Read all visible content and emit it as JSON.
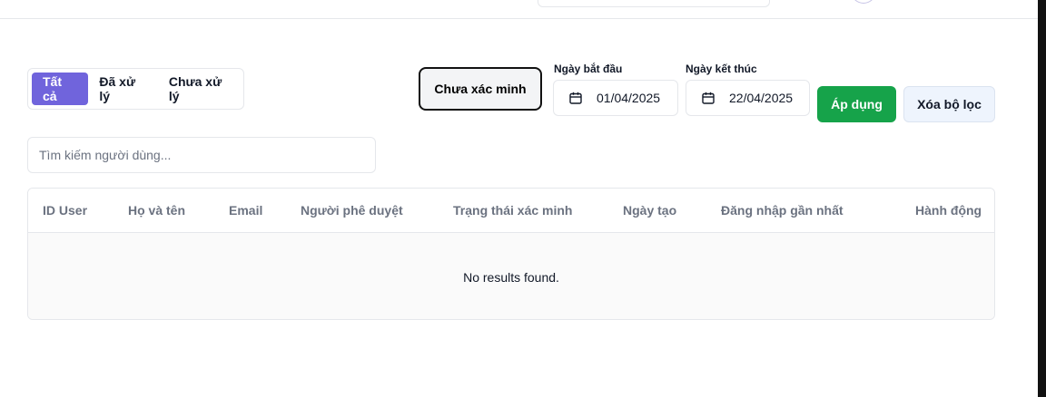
{
  "filters": {
    "tabs": [
      {
        "label": "Tất cả",
        "active": true
      },
      {
        "label": "Đã xử lý",
        "active": false
      },
      {
        "label": "Chưa xử lý",
        "active": false
      }
    ],
    "unverified_label": "Chưa xác minh",
    "start_date": {
      "label": "Ngày bắt đầu",
      "value": "01/04/2025"
    },
    "end_date": {
      "label": "Ngày kết thúc",
      "value": "22/04/2025"
    },
    "apply_label": "Áp dụng",
    "clear_label": "Xóa bộ lọc"
  },
  "search": {
    "placeholder": "Tìm kiếm người dùng..."
  },
  "table": {
    "columns": [
      "ID User",
      "Họ và tên",
      "Email",
      "Người phê duyệt",
      "Trạng thái xác minh",
      "Ngày tạo",
      "Đăng nhập gần nhất",
      "Hành động"
    ],
    "rows": [],
    "empty_text": "No results found."
  },
  "colors": {
    "accent": "#7064dc",
    "apply": "#16a34a",
    "clear_bg": "#eef4fd"
  },
  "icons": {
    "date_icon": "calendar-icon"
  }
}
